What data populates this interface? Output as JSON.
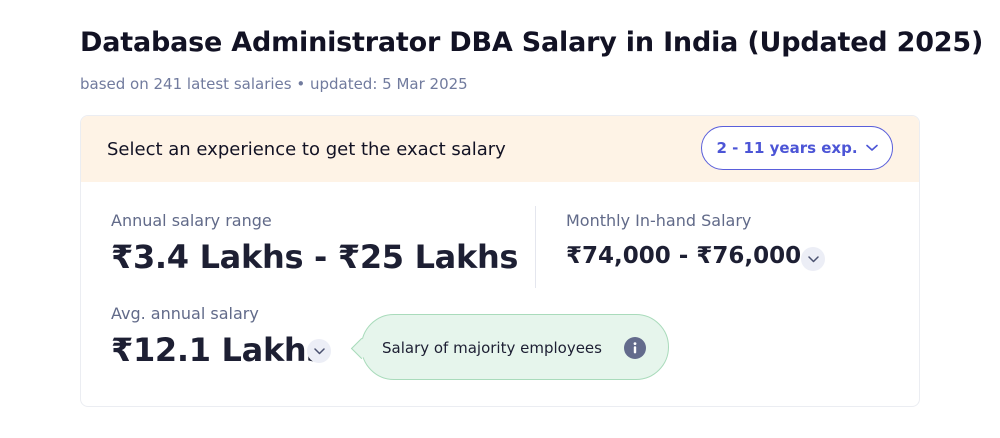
{
  "header": {
    "title": "Database Administrator DBA Salary in India (Updated 2025)",
    "subtitle": "based on 241 latest salaries • updated: 5 Mar 2025"
  },
  "experience": {
    "prompt": "Select an experience to get the exact salary",
    "selected": "2 - 11 years exp."
  },
  "salary": {
    "annual_range_label": "Annual salary range",
    "annual_range_value": "₹3.4 Lakhs - ₹25 Lakhs",
    "monthly_label": "Monthly In-hand Salary",
    "monthly_value": "₹74,000 - ₹76,000",
    "avg_label": "Avg. annual salary",
    "avg_value": "₹12.1 Lakhs"
  },
  "tooltip": {
    "text": "Salary of majority employees"
  },
  "icons": {
    "chevron": "chevron-down-icon",
    "info": "info-icon"
  },
  "colors": {
    "accent": "#4c55d6",
    "experience_bar_bg": "#fef3e6",
    "tooltip_bg": "#e6f5ec",
    "tooltip_border": "#a9dbbb"
  }
}
